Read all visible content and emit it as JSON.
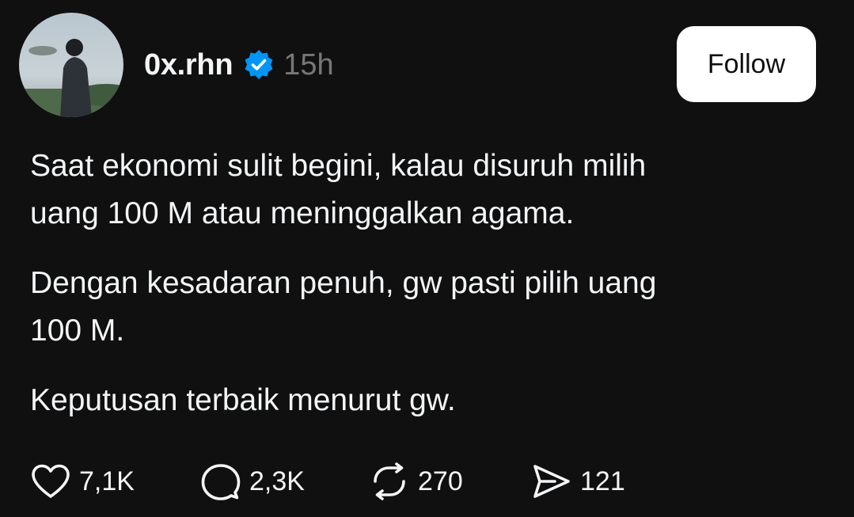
{
  "post": {
    "author": {
      "username": "0x.rhn",
      "verified": true,
      "timestamp": "15h"
    },
    "follow_label": "Follow",
    "paragraphs": [
      "Saat ekonomi sulit begini, kalau disuruh milih\nuang 100 M atau meninggalkan agama.",
      "Dengan kesadaran penuh, gw pasti pilih uang\n100 M.",
      "Keputusan terbaik menurut gw."
    ],
    "actions": {
      "like_count": "7,1K",
      "reply_count": "2,3K",
      "repost_count": "270",
      "share_count": "121"
    }
  },
  "colors": {
    "background": "#101010",
    "text": "#f3f5f7",
    "muted": "#777777",
    "verified": "#0095f6",
    "button_bg": "#ffffff"
  },
  "icons": [
    "heart-icon",
    "comment-icon",
    "repost-icon",
    "share-icon",
    "verified-badge-icon"
  ]
}
